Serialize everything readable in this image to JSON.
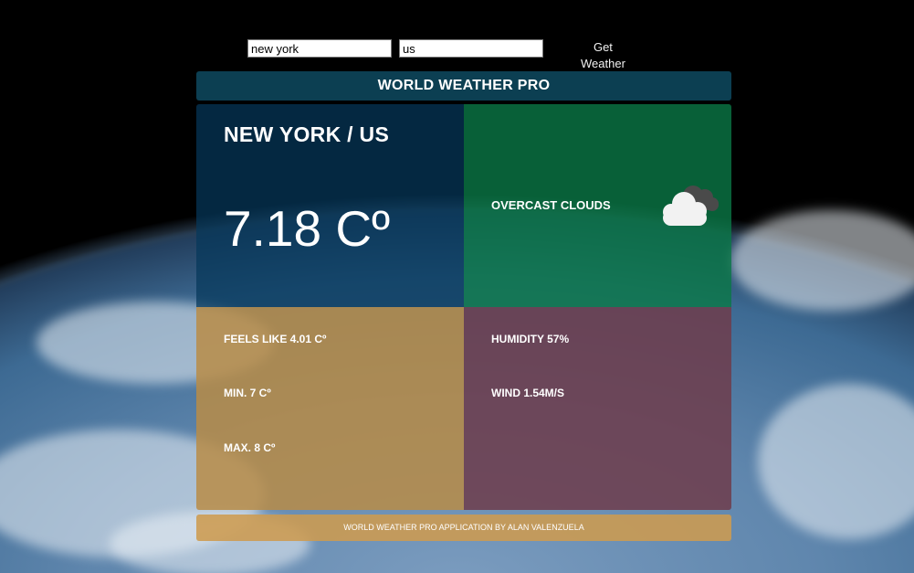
{
  "search": {
    "city_value": "new york",
    "country_value": "us",
    "submit_label": "Get Weather"
  },
  "header": {
    "title": "WORLD WEATHER PRO"
  },
  "weather": {
    "location": "NEW YORK / US",
    "temperature": "7.18 Cº",
    "condition": "OVERCAST CLOUDS",
    "condition_icon": "cloud-icon",
    "feels_like": "FEELS LIKE 4.01 Cº",
    "min": "MIN. 7 Cº",
    "max": "MAX. 8 Cº",
    "humidity": "HUMIDITY 57%",
    "wind": "WIND 1.54M/S"
  },
  "footer": {
    "credit": "WORLD WEATHER PRO APPLICATION BY ALAN VALENZUELA"
  },
  "colors": {
    "header_bg": "#0c3f52",
    "main_panel": "#05375a",
    "condition_panel": "#0a7846",
    "temps_panel": "#b98c46",
    "humidity_panel": "#6e3c4b",
    "footer_bg": "#cd9b50"
  }
}
